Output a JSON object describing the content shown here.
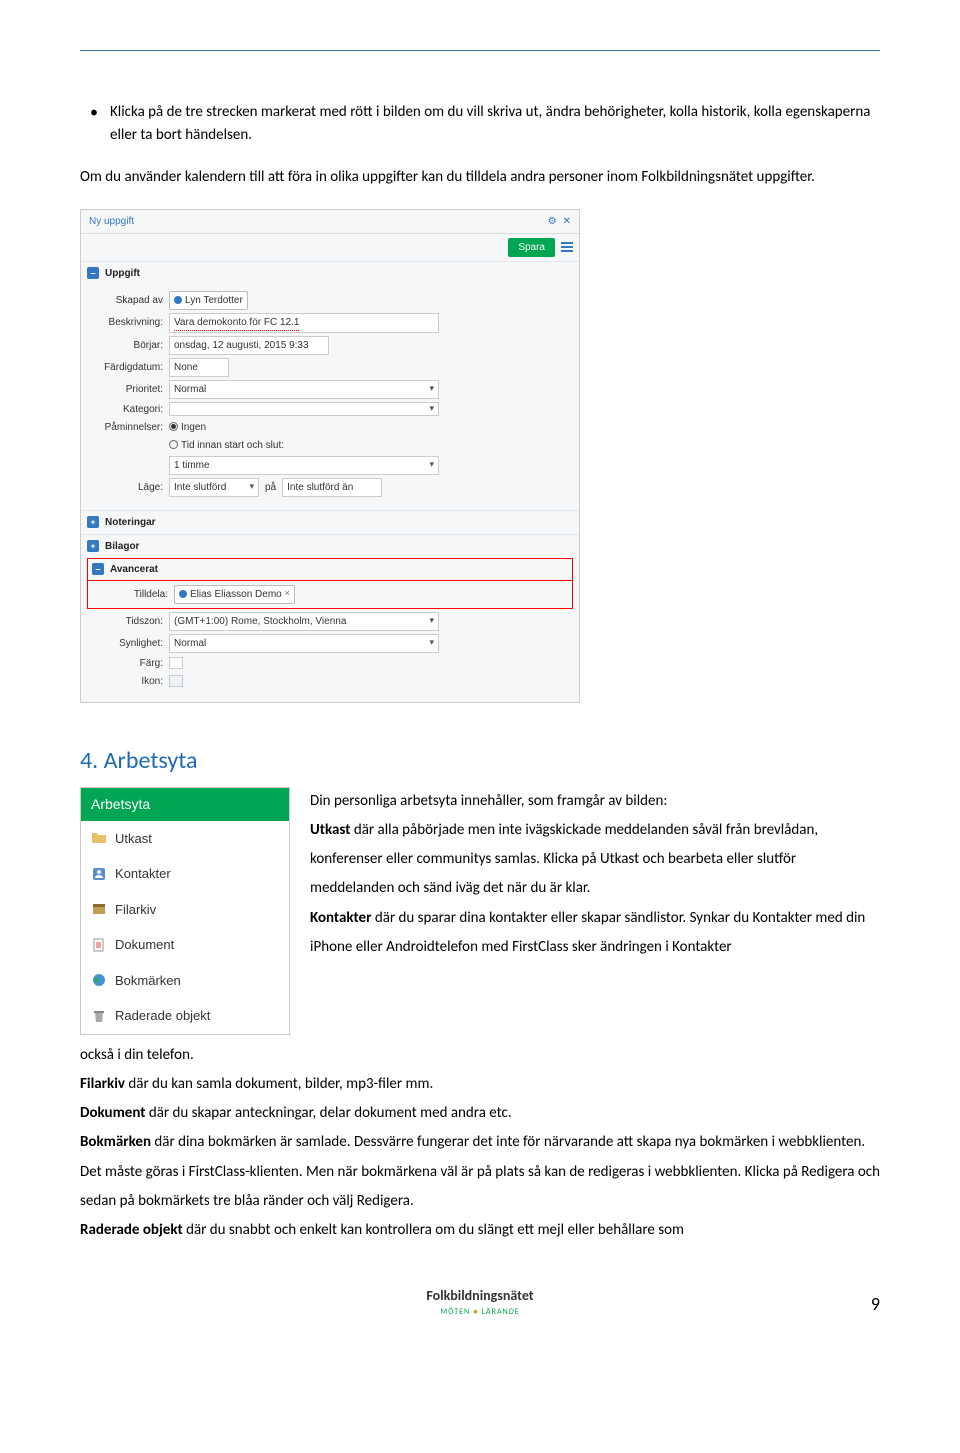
{
  "bullet_text": "Klicka på de tre strecken markerat med rött i bilden om du vill skriva ut, ändra behörigheter, kolla historik, kolla egenskaperna eller ta bort händelsen.",
  "intro_para": "Om du använder kalendern till att föra in olika uppgifter kan du tilldela andra personer inom Folkbildningsnätet uppgifter.",
  "panel": {
    "title": "Ny uppgift",
    "save": "Spara",
    "sections": {
      "uppgift": "Uppgift",
      "noteringar": "Noteringar",
      "bilagor": "Bilagor",
      "avancerat": "Avancerat"
    },
    "labels": {
      "skapad_av": "Skapad av",
      "beskrivning": "Beskrivning:",
      "borjar": "Börjar:",
      "fardigdatum": "Färdigdatum:",
      "prioritet": "Prioritet:",
      "kategori": "Kategori:",
      "paminnelser": "Påminnelser:",
      "lage": "Läge:",
      "pa": "på",
      "tilldela": "Tilldela:",
      "tidszon": "Tidszon:",
      "synlighet": "Synlighet:",
      "farg": "Färg:",
      "ikon": "Ikon:"
    },
    "values": {
      "skapad_av": "Lyn Terdotter",
      "beskrivning": "Vara demokonto för FC 12.1",
      "borjar": "onsdag, 12 augusti, 2015 9:33",
      "fardigdatum": "None",
      "prioritet": "Normal",
      "kategori": "",
      "paminnelser_opt1": "Ingen",
      "paminnelser_opt2": "Tid innan start och slut:",
      "paminnelser_time": "1 timme",
      "lage1": "Inte slutförd",
      "lage2": "Inte slutförd än",
      "tilldela": "Elias Eliasson Demo",
      "tidszon": "(GMT+1:00) Rome, Stockholm, Vienna",
      "synlighet": "Normal"
    }
  },
  "heading": "4. Arbetsyta",
  "arbetsyta": {
    "header": "Arbetsyta",
    "items": [
      "Utkast",
      "Kontakter",
      "Filarkiv",
      "Dokument",
      "Bokmärken",
      "Raderade objekt"
    ]
  },
  "body": {
    "intro": "Din personliga arbetsyta innehåller, som framgår av bilden:",
    "utkast_label": "Utkast",
    "utkast_text": " där alla påbörjade men inte ivägskickade meddelanden såväl från brevlådan, konferenser eller communitys samlas. Klicka på Utkast och bearbeta eller slutför meddelanden och sänd iväg det när du är klar.",
    "kontakter_label": "Kontakter",
    "kontakter_text": " där du sparar dina kontakter eller skapar sändlistor. Synkar du Kontakter med din iPhone eller Androidtelefon med FirstClass sker ändringen i Kontakter",
    "phone_suffix": "också i din telefon.",
    "filarkiv_label": "Filarkiv",
    "filarkiv_text": " där du kan samla dokument, bilder, mp3-filer mm.",
    "dokument_label": "Dokument",
    "dokument_text": " där du skapar anteckningar, delar dokument med andra etc.",
    "bokmarken_label": "Bokmärken",
    "bokmarken_text": " där dina bokmärken är samlade. Dessvärre fungerar det inte för närvarande att skapa nya bokmärken i webbklienten. Det måste göras i FirstClass-klienten. Men när bokmärkena väl är på plats så kan de redigeras i webbklienten. Klicka på Redigera och sedan på bokmärkets tre blåa ränder och välj Redigera.",
    "raderade_label": "Raderade objekt",
    "raderade_text": " där du snabbt och enkelt kan kontrollera om du slängt ett mejl eller behållare som"
  },
  "footer": {
    "brand": "Folkbildningsnätet",
    "sub_left": "MÖTEN",
    "sub_right": "LÄRANDE",
    "page": "9"
  }
}
